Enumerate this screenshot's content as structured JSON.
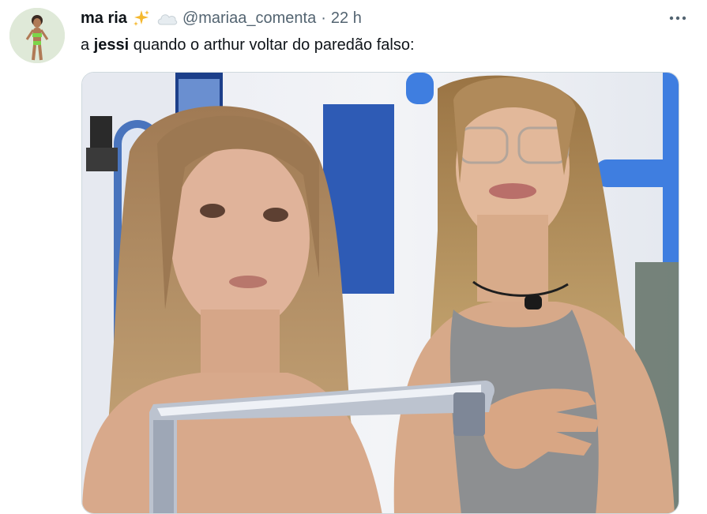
{
  "tweet": {
    "author_name": "ma ria",
    "handle": "@mariaa_comenta",
    "separator": "·",
    "timestamp": "22 h",
    "text_prefix": "a ",
    "text_bold": "jessi",
    "text_suffix": " quando o arthur voltar do paredão falso:"
  },
  "icons": {
    "more": "more-horizontal-icon",
    "emoji_1": "sparkles-icon",
    "emoji_2": "cloud-icon"
  },
  "colors": {
    "text_primary": "#0f1419",
    "text_secondary": "#536471",
    "media_border": "#cfd9de"
  }
}
